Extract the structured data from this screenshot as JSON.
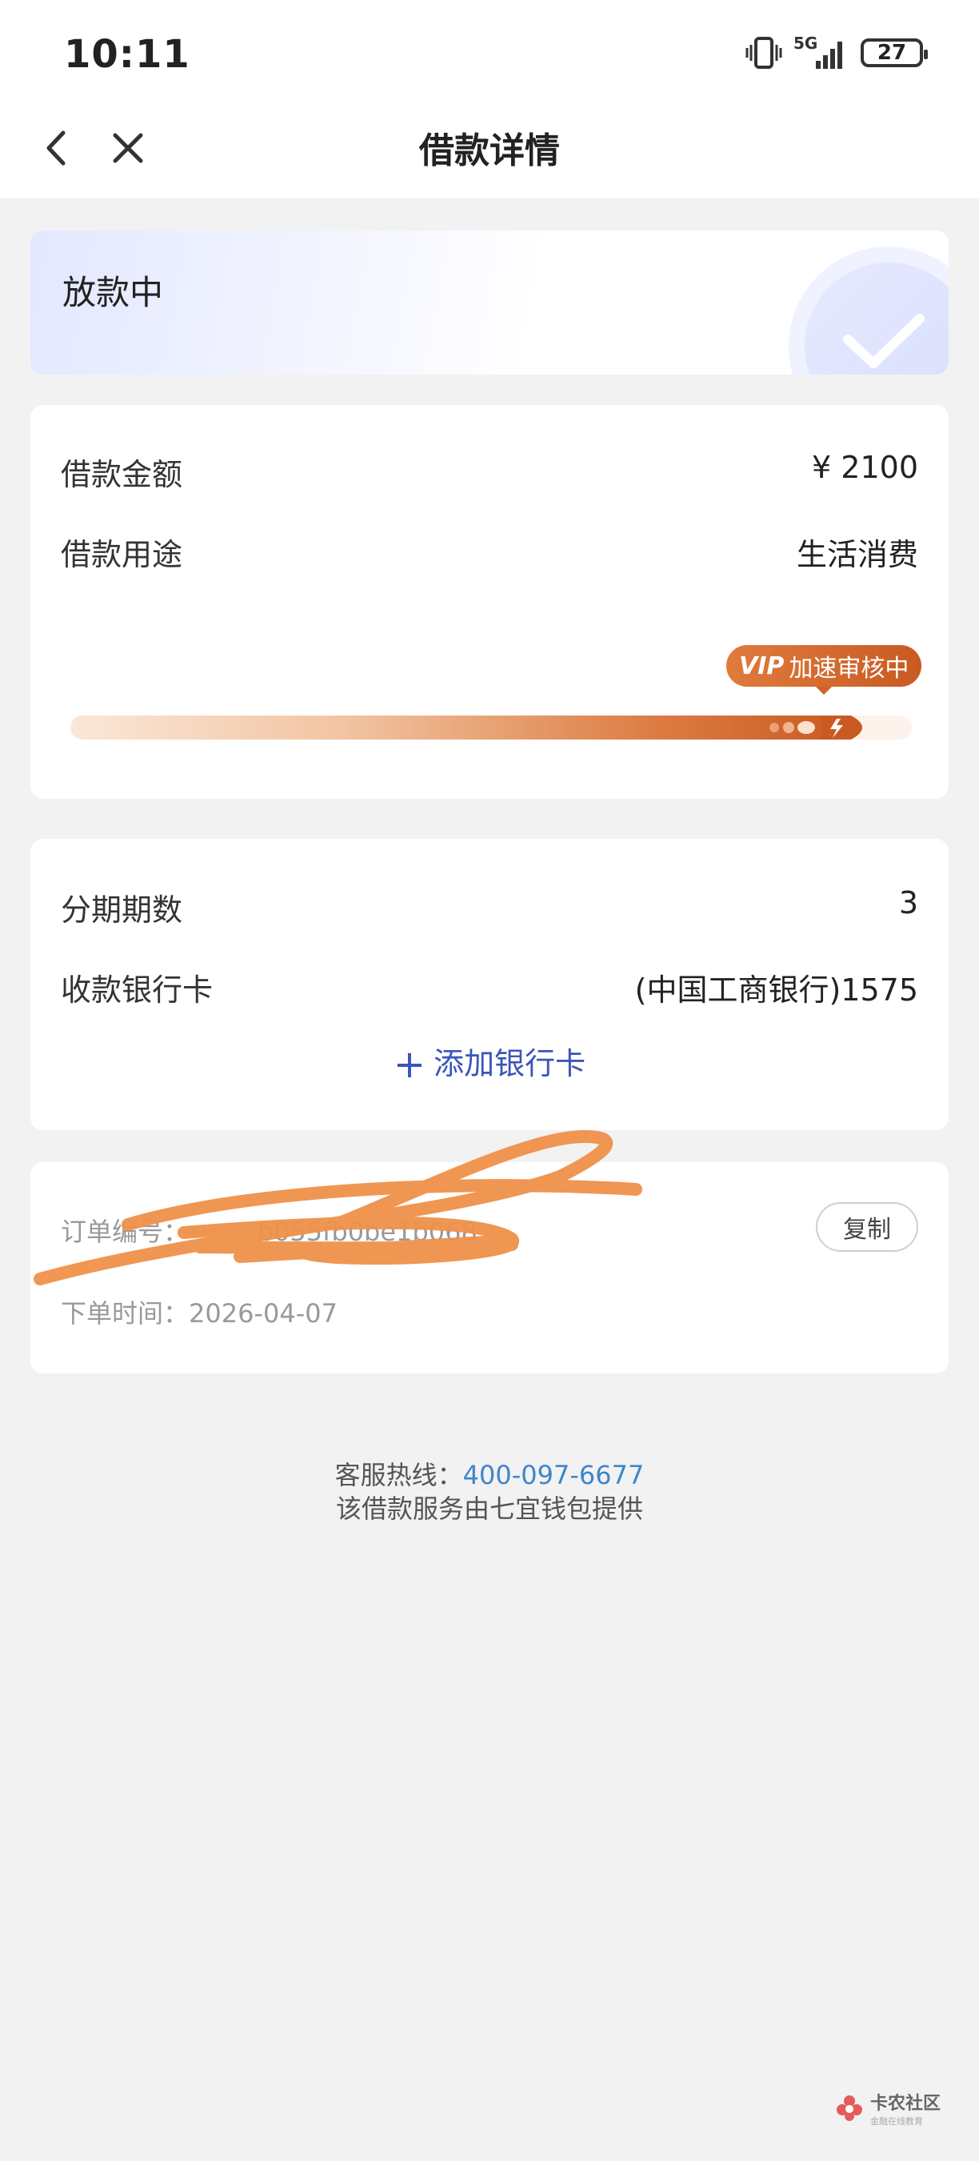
{
  "status_bar": {
    "time": "10:11",
    "network": "5G",
    "battery": "27"
  },
  "nav": {
    "title": "借款详情"
  },
  "status_card": {
    "text": "放款中"
  },
  "loan": {
    "amount_label": "借款金额",
    "amount_value": "¥ 2100",
    "purpose_label": "借款用途",
    "purpose_value": "生活消费",
    "vip_badge": "加速审核中",
    "vip_mark": "VIP",
    "progress": 0.93
  },
  "installment": {
    "periods_label": "分期期数",
    "periods_value": "3",
    "card_label": "收款银行卡",
    "card_value": "(中国工商银行)1575",
    "add_card": "添加银行卡"
  },
  "order": {
    "number_line": "订单编号：··········b055fb0be1b068",
    "time_line": "下单时间：2026-04-07",
    "copy_label": "复制"
  },
  "footer": {
    "hotline_label": "客服热线：",
    "hotline_number": "400-097-6677",
    "provider_text": "该借款服务由七宜钱包提供"
  },
  "watermark": {
    "main": "卡农社区",
    "sub": "金融在线教育"
  },
  "colors": {
    "accent_blue": "#3a56b8",
    "link_blue": "#3f86c9",
    "vip_orange": "#c95a22",
    "scribble": "#f0914a"
  }
}
